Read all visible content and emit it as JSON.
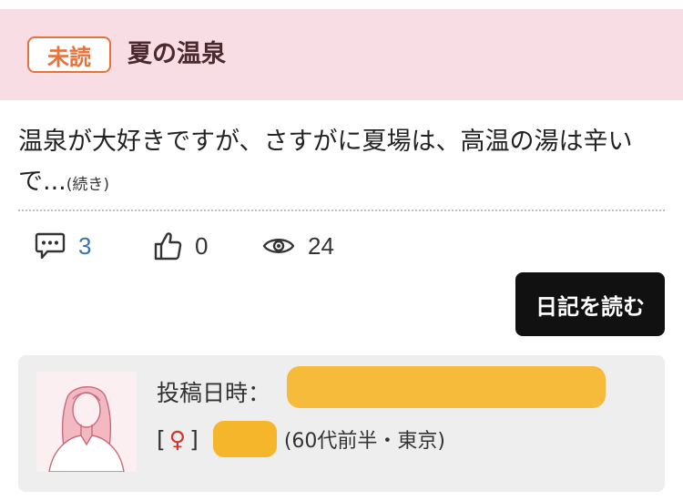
{
  "header": {
    "badge": "未読",
    "title": "夏の温泉"
  },
  "post": {
    "excerpt": "温泉が大好きですが、さすがに夏場は、高温の湯は辛いで...",
    "more": "(続き)"
  },
  "stats": {
    "comments": "3",
    "likes": "0",
    "views": "24"
  },
  "read_button": "日記を読む",
  "author": {
    "posted_label": "投稿日時：",
    "bracket_open": "[",
    "gender_symbol": "♀",
    "bracket_close": "]",
    "age_location": "(60代前半・東京)"
  },
  "colors": {
    "header_bg": "#f8dde4",
    "badge_accent": "#e4733c",
    "link_blue": "#3a6fb0",
    "button_bg": "#111111",
    "card_bg": "#eeeeee",
    "female_red": "#d4332b",
    "redaction": "#f6b62b"
  },
  "icons": {
    "comments": "speech-bubble-icon",
    "likes": "thumbs-up-icon",
    "views": "eye-icon",
    "avatar": "woman-avatar-illustration"
  }
}
